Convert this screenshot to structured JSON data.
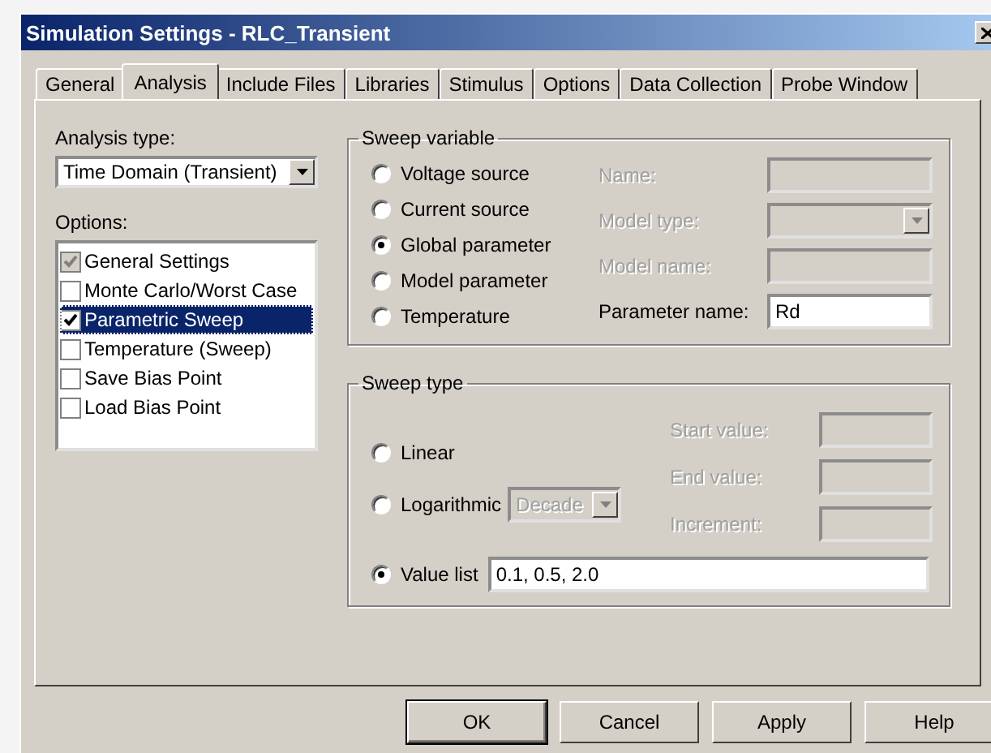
{
  "window": {
    "title": "Simulation Settings - RLC_Transient"
  },
  "tabs": [
    {
      "label": "General",
      "selected": false
    },
    {
      "label": "Analysis",
      "selected": true
    },
    {
      "label": "Include Files",
      "selected": false
    },
    {
      "label": "Libraries",
      "selected": false
    },
    {
      "label": "Stimulus",
      "selected": false
    },
    {
      "label": "Options",
      "selected": false
    },
    {
      "label": "Data Collection",
      "selected": false
    },
    {
      "label": "Probe Window",
      "selected": false
    }
  ],
  "analysis_type": {
    "label": "Analysis type:",
    "value": "Time Domain (Transient)"
  },
  "options": {
    "label": "Options:",
    "items": [
      {
        "label": "General Settings",
        "checked": true,
        "disabled": true,
        "selected": false
      },
      {
        "label": "Monte Carlo/Worst Case",
        "checked": false,
        "disabled": false,
        "selected": false
      },
      {
        "label": "Parametric Sweep",
        "checked": true,
        "disabled": false,
        "selected": true
      },
      {
        "label": "Temperature (Sweep)",
        "checked": false,
        "disabled": false,
        "selected": false
      },
      {
        "label": "Save Bias Point",
        "checked": false,
        "disabled": false,
        "selected": false
      },
      {
        "label": "Load Bias Point",
        "checked": false,
        "disabled": false,
        "selected": false
      }
    ]
  },
  "sweep_variable": {
    "title": "Sweep variable",
    "choices": [
      {
        "label": "Voltage source",
        "selected": false
      },
      {
        "label": "Current source",
        "selected": false
      },
      {
        "label": "Global parameter",
        "selected": true
      },
      {
        "label": "Model parameter",
        "selected": false
      },
      {
        "label": "Temperature",
        "selected": false
      }
    ],
    "fields": [
      {
        "label": "Name:",
        "kind": "text",
        "disabled": true
      },
      {
        "label": "Model type:",
        "kind": "dropdown",
        "disabled": true
      },
      {
        "label": "Model name:",
        "kind": "text",
        "disabled": true
      },
      {
        "label": "Parameter name:",
        "kind": "text",
        "disabled": false,
        "value": "Rd"
      }
    ]
  },
  "sweep_type": {
    "title": "Sweep type",
    "choices": [
      {
        "kind": "plain",
        "label": "Linear",
        "selected": false
      },
      {
        "kind": "dropdown",
        "label": "Logarithmic",
        "selected": false,
        "dropdown": {
          "value": "Decade",
          "disabled": true
        }
      },
      {
        "kind": "text",
        "label": "Value list",
        "selected": true,
        "value": "0.1, 0.5, 2.0"
      }
    ],
    "range_fields": [
      {
        "label": "Start value:",
        "disabled": true
      },
      {
        "label": "End value:",
        "disabled": true
      },
      {
        "label": "Increment:",
        "disabled": true
      }
    ]
  },
  "buttons": [
    {
      "label": "OK",
      "default": true
    },
    {
      "label": "Cancel",
      "default": false
    },
    {
      "label": "Apply",
      "default": false
    },
    {
      "label": "Help",
      "default": false
    }
  ]
}
